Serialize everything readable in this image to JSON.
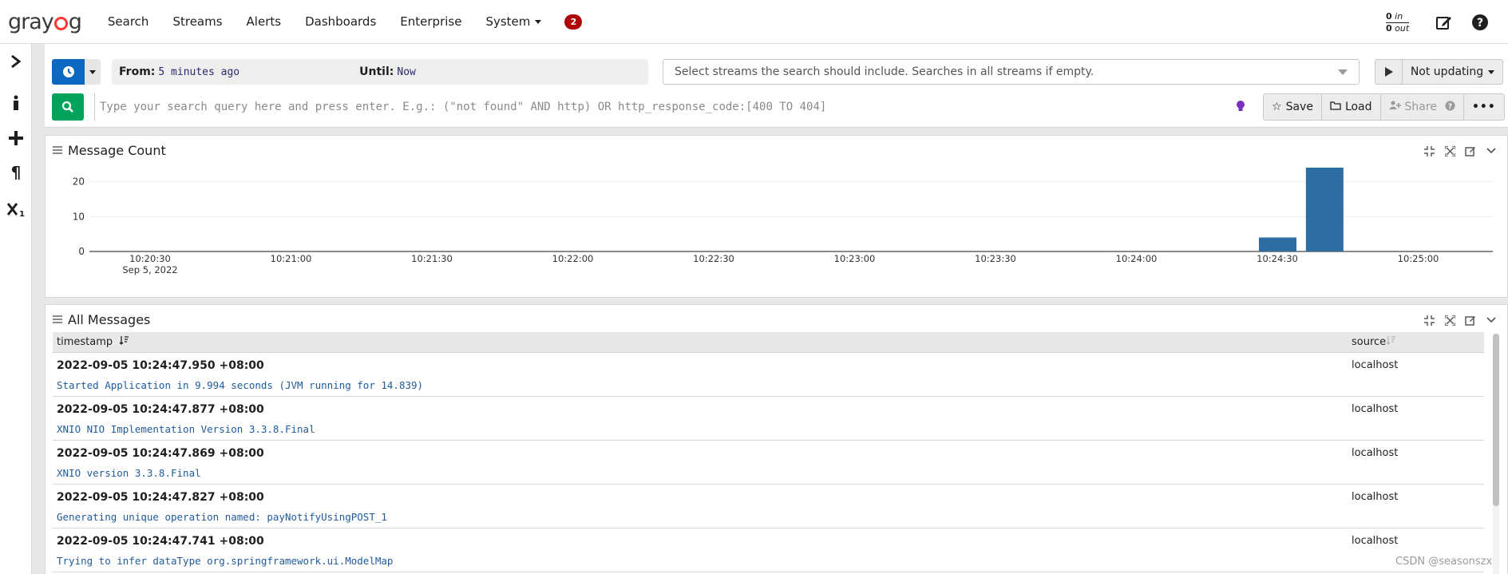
{
  "nav": {
    "logo_pre": "gray",
    "logo_post": "g",
    "items": [
      "Search",
      "Streams",
      "Alerts",
      "Dashboards",
      "Enterprise",
      "System"
    ],
    "notifications": "2",
    "throughput_in_value": "0",
    "throughput_in_label": "in",
    "throughput_out_value": "0",
    "throughput_out_label": "out"
  },
  "search": {
    "from_label": "From:",
    "from_value": "5 minutes ago",
    "until_label": "Until:",
    "until_value": "Now",
    "streams_placeholder": "Select streams the search should include. Searches in all streams if empty.",
    "refresh_label": "Not updating",
    "query_placeholder": "Type your search query here and press enter. E.g.: (\"not found\" AND http) OR http_response_code:[400 TO 404]",
    "save_label": "Save",
    "load_label": "Load",
    "share_label": "Share"
  },
  "message_count": {
    "title": "Message Count"
  },
  "chart_data": {
    "type": "bar",
    "title": "",
    "xlabel": "",
    "ylabel": "",
    "y_ticks": [
      "20",
      "10",
      "0"
    ],
    "ylim": [
      0,
      24
    ],
    "x_ticks": [
      "10:20:30",
      "10:21:00",
      "10:21:30",
      "10:22:00",
      "10:22:30",
      "10:23:00",
      "10:23:30",
      "10:24:00",
      "10:24:30",
      "10:25:00"
    ],
    "x_date_label": "Sep 5, 2022",
    "bars": [
      {
        "x": "10:24:30",
        "value": 4
      },
      {
        "x": "10:24:40",
        "value": 24
      }
    ],
    "color": "#2e6da4",
    "grid": true
  },
  "all_messages": {
    "title": "All Messages",
    "columns": {
      "timestamp": "timestamp",
      "source": "source"
    },
    "rows": [
      {
        "timestamp": "2022-09-05 10:24:47.950 +08:00",
        "message": "Started Application in 9.994 seconds (JVM running for 14.839)",
        "source": "localhost"
      },
      {
        "timestamp": "2022-09-05 10:24:47.877 +08:00",
        "message": "XNIO NIO Implementation Version 3.3.8.Final",
        "source": "localhost"
      },
      {
        "timestamp": "2022-09-05 10:24:47.869 +08:00",
        "message": "XNIO version 3.3.8.Final",
        "source": "localhost"
      },
      {
        "timestamp": "2022-09-05 10:24:47.827 +08:00",
        "message": "Generating unique operation named: payNotifyUsingPOST_1",
        "source": "localhost"
      },
      {
        "timestamp": "2022-09-05 10:24:47.741 +08:00",
        "message": "Trying to infer dataType org.springframework.ui.ModelMap",
        "source": "localhost"
      }
    ]
  },
  "watermark": "CSDN @seasonszx",
  "colors": {
    "primary": "#0a68c0",
    "success": "#00a35c",
    "badge": "#ad0707",
    "bar": "#2e6da4",
    "message": "#1f5b9e"
  }
}
